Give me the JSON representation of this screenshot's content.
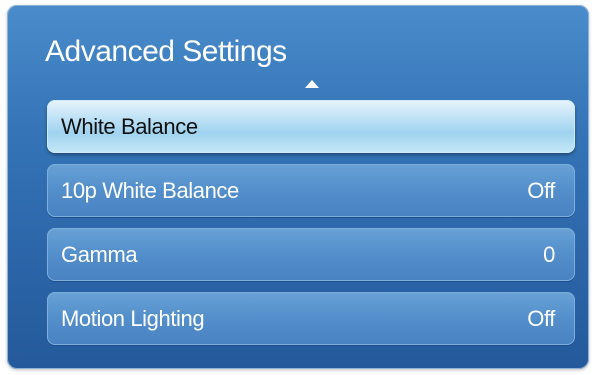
{
  "window": {
    "title": "Advanced Settings"
  },
  "menu": {
    "items": [
      {
        "label": "White Balance",
        "value": ""
      },
      {
        "label": "10p White Balance",
        "value": "Off"
      },
      {
        "label": "Gamma",
        "value": "0"
      },
      {
        "label": "Motion Lighting",
        "value": "Off"
      }
    ],
    "selected_index": 0
  },
  "icons": {
    "scroll_up": "triangle-up-icon"
  },
  "colors": {
    "panel": "#3474b7",
    "item": "#5490cc",
    "selected_item": "#b7dff4",
    "text": "#ffffff",
    "selected_text": "#111111"
  }
}
